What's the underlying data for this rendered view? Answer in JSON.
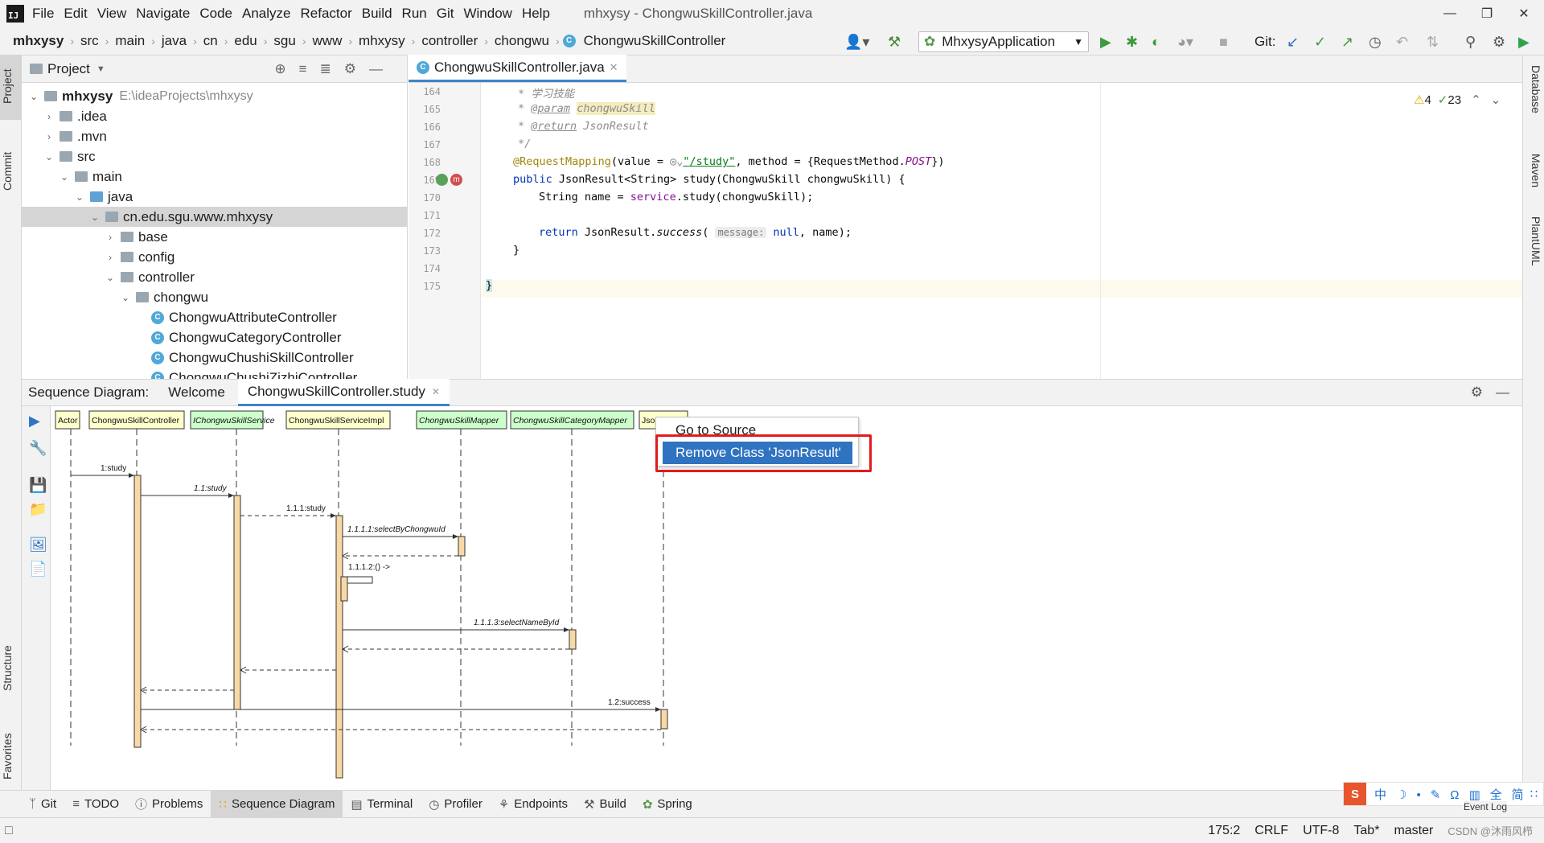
{
  "window": {
    "title": "mhxysy - ChongwuSkillController.java",
    "menu": [
      "File",
      "Edit",
      "View",
      "Navigate",
      "Code",
      "Analyze",
      "Refactor",
      "Build",
      "Run",
      "Git",
      "Window",
      "Help"
    ]
  },
  "breadcrumb": [
    "mhxysy",
    "src",
    "main",
    "java",
    "cn",
    "edu",
    "sgu",
    "www",
    "mhxysy",
    "controller",
    "chongwu",
    "ChongwuSkillController"
  ],
  "toolbar": {
    "run_config": "MhxysyApplication",
    "git_label": "Git:"
  },
  "project_panel": {
    "title": "Project",
    "tree": [
      {
        "label": "mhxysy",
        "extra": "E:\\ideaProjects\\mhxysy",
        "depth": 0,
        "open": true,
        "kind": "folder"
      },
      {
        "label": ".idea",
        "depth": 1,
        "open": false,
        "kind": "folder"
      },
      {
        "label": ".mvn",
        "depth": 1,
        "open": false,
        "kind": "folder"
      },
      {
        "label": "src",
        "depth": 1,
        "open": true,
        "kind": "folder"
      },
      {
        "label": "main",
        "depth": 2,
        "open": true,
        "kind": "folder"
      },
      {
        "label": "java",
        "depth": 3,
        "open": true,
        "kind": "folder-blue"
      },
      {
        "label": "cn.edu.sgu.www.mhxysy",
        "depth": 4,
        "open": true,
        "kind": "folder",
        "selected": true
      },
      {
        "label": "base",
        "depth": 5,
        "open": false,
        "kind": "folder"
      },
      {
        "label": "config",
        "depth": 5,
        "open": false,
        "kind": "folder"
      },
      {
        "label": "controller",
        "depth": 5,
        "open": true,
        "kind": "folder"
      },
      {
        "label": "chongwu",
        "depth": 6,
        "open": true,
        "kind": "folder"
      },
      {
        "label": "ChongwuAttributeController",
        "depth": 7,
        "kind": "class"
      },
      {
        "label": "ChongwuCategoryController",
        "depth": 7,
        "kind": "class"
      },
      {
        "label": "ChongwuChushiSkillController",
        "depth": 7,
        "kind": "class"
      },
      {
        "label": "ChongwuChushiZizhiController",
        "depth": 7,
        "kind": "class"
      }
    ]
  },
  "editor": {
    "tab": "ChongwuSkillController.java",
    "warnings": "4",
    "checks": "23",
    "lines": [
      {
        "n": "164",
        "text": "* 学习技能"
      },
      {
        "n": "165",
        "text": "* @param chongwuSkill"
      },
      {
        "n": "166",
        "text": "* @return JsonResult"
      },
      {
        "n": "167",
        "text": "*/"
      },
      {
        "n": "168",
        "text": "@RequestMapping(value = \"/study\", method = {RequestMethod.POST})"
      },
      {
        "n": "169",
        "text": "public JsonResult<String> study(ChongwuSkill chongwuSkill) {"
      },
      {
        "n": "170",
        "text": "String name = service.study(chongwuSkill);"
      },
      {
        "n": "171",
        "text": ""
      },
      {
        "n": "172",
        "text": "return JsonResult.success( message: null, name);"
      },
      {
        "n": "173",
        "text": "}"
      },
      {
        "n": "174",
        "text": ""
      },
      {
        "n": "175",
        "text": "}"
      }
    ],
    "tokens": {
      "c164": "* 学习技能",
      "c165a": "* ",
      "c165b": "@param",
      "c165c": "chongwuSkill",
      "c166a": "* ",
      "c166b": "@return",
      "c166c": " JsonResult",
      "c167": "*/",
      "c168a": "@RequestMapping",
      "c168b": "(value = ",
      "c168c": "\"/study\"",
      "c168d": ", method = {RequestMethod.",
      "c168e": "POST",
      "c168f": "})",
      "c169a": "public ",
      "c169b": "JsonResult<String> study(ChongwuSkill chongwuSkill) {",
      "c170a": "String name = ",
      "c170b": "service",
      "c170c": ".study(chongwuSkill);",
      "c172a": "return ",
      "c172b": "JsonResult.",
      "c172c": "success",
      "c172d": "( ",
      "c172e": "message:",
      "c172f": " null",
      "c172g": ", name);",
      "c173": "}",
      "c175": "}"
    }
  },
  "sequence": {
    "header_label": "Sequence Diagram:",
    "tabs": [
      "Welcome",
      "ChongwuSkillController.study"
    ],
    "participants": [
      "Actor",
      "ChongwuSkillController",
      "IChongwuSkillService",
      "ChongwuSkillServiceImpl",
      "ChongwuSkillMapper",
      "ChongwuSkillCategoryMapper",
      "Json"
    ],
    "messages": [
      "1:study",
      "1.1:study",
      "1.1.1:study",
      "1.1.1.1:selectByChongwuId",
      "1.1.1.2:() ->",
      "1.1.1.3:selectNameById",
      "1.2:success"
    ],
    "context_menu": {
      "go_to_source": "Go to Source",
      "remove_class": "Remove Class 'JsonResult'"
    }
  },
  "tool_windows": [
    "Git",
    "TODO",
    "Problems",
    "Sequence Diagram",
    "Terminal",
    "Profiler",
    "Endpoints",
    "Build",
    "Spring"
  ],
  "left_strip": [
    "Project",
    "Commit",
    "Structure",
    "Favorites"
  ],
  "right_strip": [
    "Database",
    "Maven",
    "PlantUML"
  ],
  "status": {
    "position": "175:2",
    "line_sep": "CRLF",
    "encoding": "UTF-8",
    "indent": "Tab*",
    "branch": "master",
    "event_log": "Event Log",
    "watermark": "CSDN @沐雨风栉"
  },
  "ime": [
    "中",
    "简"
  ],
  "colors": {
    "accent": "#2f73c1",
    "highlight_box": "#e31b1b",
    "lifeline_bar": "#f8d9a6"
  }
}
